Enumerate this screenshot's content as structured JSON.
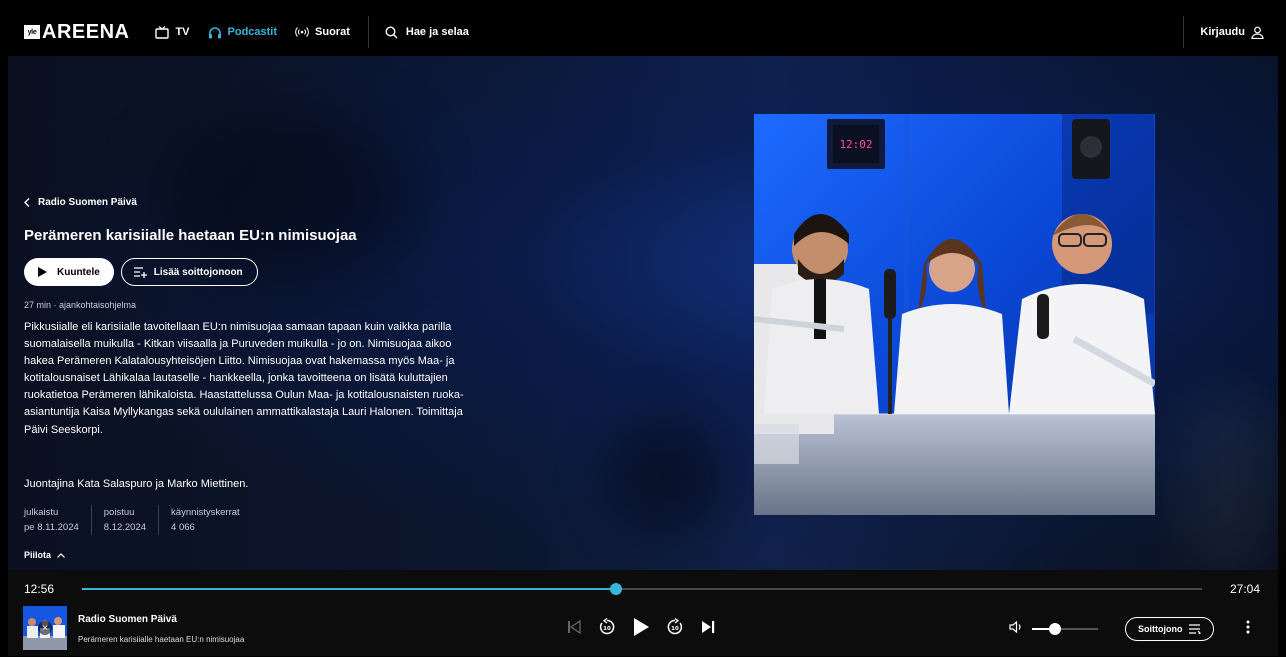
{
  "nav": {
    "logo_badge": "yle",
    "logo_text": "AREENA",
    "items": [
      {
        "label": "TV",
        "icon": "tv-icon",
        "active": false
      },
      {
        "label": "Podcastit",
        "icon": "headphones-icon",
        "active": true
      },
      {
        "label": "Suorat",
        "icon": "broadcast-icon",
        "active": false
      }
    ],
    "search_label": "Hae ja selaa",
    "login_label": "Kirjaudu"
  },
  "episode": {
    "series": "Radio Suomen Päivä",
    "title": "Perämeren karisiialle haetaan EU:n nimisuojaa",
    "listen_label": "Kuuntele",
    "queue_label": "Lisää soittojonoon",
    "meta": "27 min · ajankohtaisohjelma",
    "description": "Pikkusiialle eli karisiialle tavoitellaan EU:n nimisuojaa samaan tapaan kuin vaikka parilla suomalaisella muikulla - Kitkan viisaalla ja Puruveden muikulla - jo on. Nimisuojaa aikoo hakea Perämeren Kalatalousyhteisöjen Liitto. Nimisuojaa ovat hakemassa myös Maa- ja kotitalousnaiset Lähikalaa lautaselle - hankkeella, jonka tavoitteena on lisätä kuluttajien ruokatietoa Perämeren lähikaloista. Haastattelussa Oulun Maa- ja kotitalousnaisten ruoka-asiantuntija Kaisa Myllykangas sekä oululainen ammattikalastaja Lauri Halonen. Toimittaja Päivi Seeskorpi.",
    "hosts": "Juontajina Kata Salaspuro ja Marko Miettinen.",
    "facts": [
      {
        "label": "julkaistu",
        "value": "pe 8.11.2024"
      },
      {
        "label": "poistuu",
        "value": "8.12.2024"
      },
      {
        "label": "käynnistyskerrat",
        "value": "4 066"
      }
    ],
    "hide_label": "Piilota",
    "artwork_clock": "12:02"
  },
  "player": {
    "elapsed": "12:56",
    "duration": "27:04",
    "progress": 0.477,
    "now_playing_title": "Radio Suomen Päivä",
    "now_playing_subtitle": "Perämeren karisiialle haetaan EU:n nimisuojaa",
    "volume": 0.35,
    "queue_label": "Soittojono"
  },
  "colors": {
    "accent": "#38b6d8",
    "topbar": "#000000",
    "player_bg": "#0c0c0c"
  }
}
